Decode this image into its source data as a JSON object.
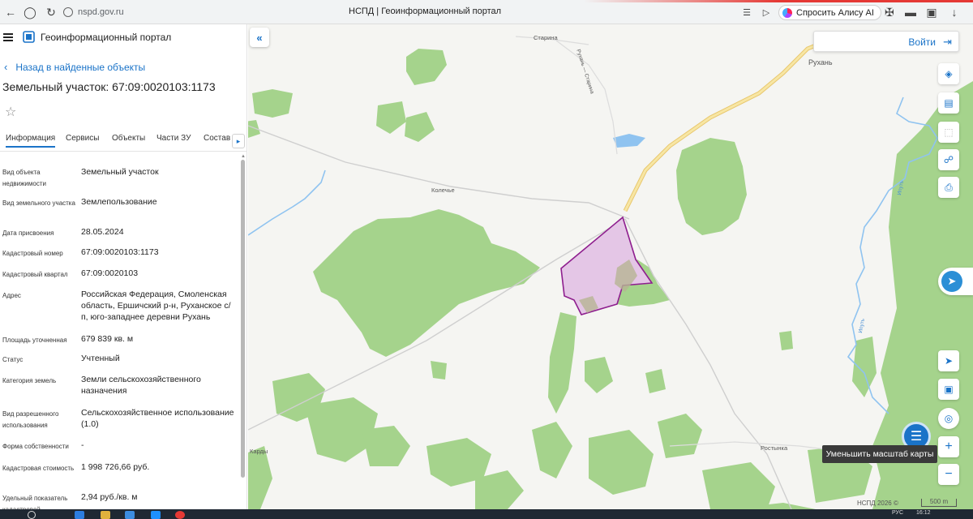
{
  "browser": {
    "url": "nspd.gov.ru",
    "tab_title": "НСПД | Геоинформационный портал",
    "alice_label": "Спросить Алису AI"
  },
  "panel": {
    "portal_title": "Геоинформационный портал",
    "back_label": "Назад в найденные объекты",
    "object_title": "Земельный участок: 67:09:0020103:1173",
    "tabs": [
      {
        "label": "Информация"
      },
      {
        "label": "Сервисы"
      },
      {
        "label": "Объекты"
      },
      {
        "label": "Части ЗУ"
      },
      {
        "label": "Состав"
      }
    ],
    "rows": [
      {
        "label": "Вид объекта недвижимости",
        "value": "Земельный участок"
      },
      {
        "label": "Вид земельного участка",
        "value": "Землепользование"
      },
      {
        "label": "Дата присвоения",
        "value": "28.05.2024"
      },
      {
        "label": "Кадастровый номер",
        "value": "67:09:0020103:1173"
      },
      {
        "label": "Кадастровый квартал",
        "value": "67:09:0020103"
      },
      {
        "label": "Адрес",
        "value": "Российская Федерация, Смоленская область, Ершичский р-н, Руханское с/п, юго-западнее деревни Рухань"
      },
      {
        "label": "Площадь уточненная",
        "value": "679 839 кв. м"
      },
      {
        "label": "Статус",
        "value": "Учтенный"
      },
      {
        "label": "Категория земель",
        "value": "Земли сельскохозяйственного назначения"
      },
      {
        "label": "Вид разрешенного использования",
        "value": "Сельскохозяйственное использование (1.0)"
      },
      {
        "label": "Форма собственности",
        "value": "-"
      },
      {
        "label": "Кадастровая стоимость",
        "value": "1 998 726,66 руб."
      },
      {
        "label": "Удельный показатель кадастровой",
        "value": "2,94 руб./кв. м"
      }
    ]
  },
  "map": {
    "login_label": "Войти",
    "tooltip": "Уменьшить масштаб карты",
    "copyright": "НСПД 2026 ©",
    "scale": "500 m",
    "places": {
      "starina": "Старина",
      "rukhan": "Рухань",
      "road_label": "Рухань — Старина",
      "kolechye": "Колечье",
      "kardy": "Карды",
      "rostynka": "Ростынка",
      "iput": "Ипуть"
    },
    "colors": {
      "forest": "#a5d38c",
      "parcel_fill": "#e4c6e6",
      "parcel_stroke": "#8e1e8e",
      "road": "#f3dc8a",
      "water": "#8fc3f0",
      "accent": "#1a73c8"
    }
  },
  "taskbar": {
    "time": "16:12",
    "lang": "РУС"
  }
}
